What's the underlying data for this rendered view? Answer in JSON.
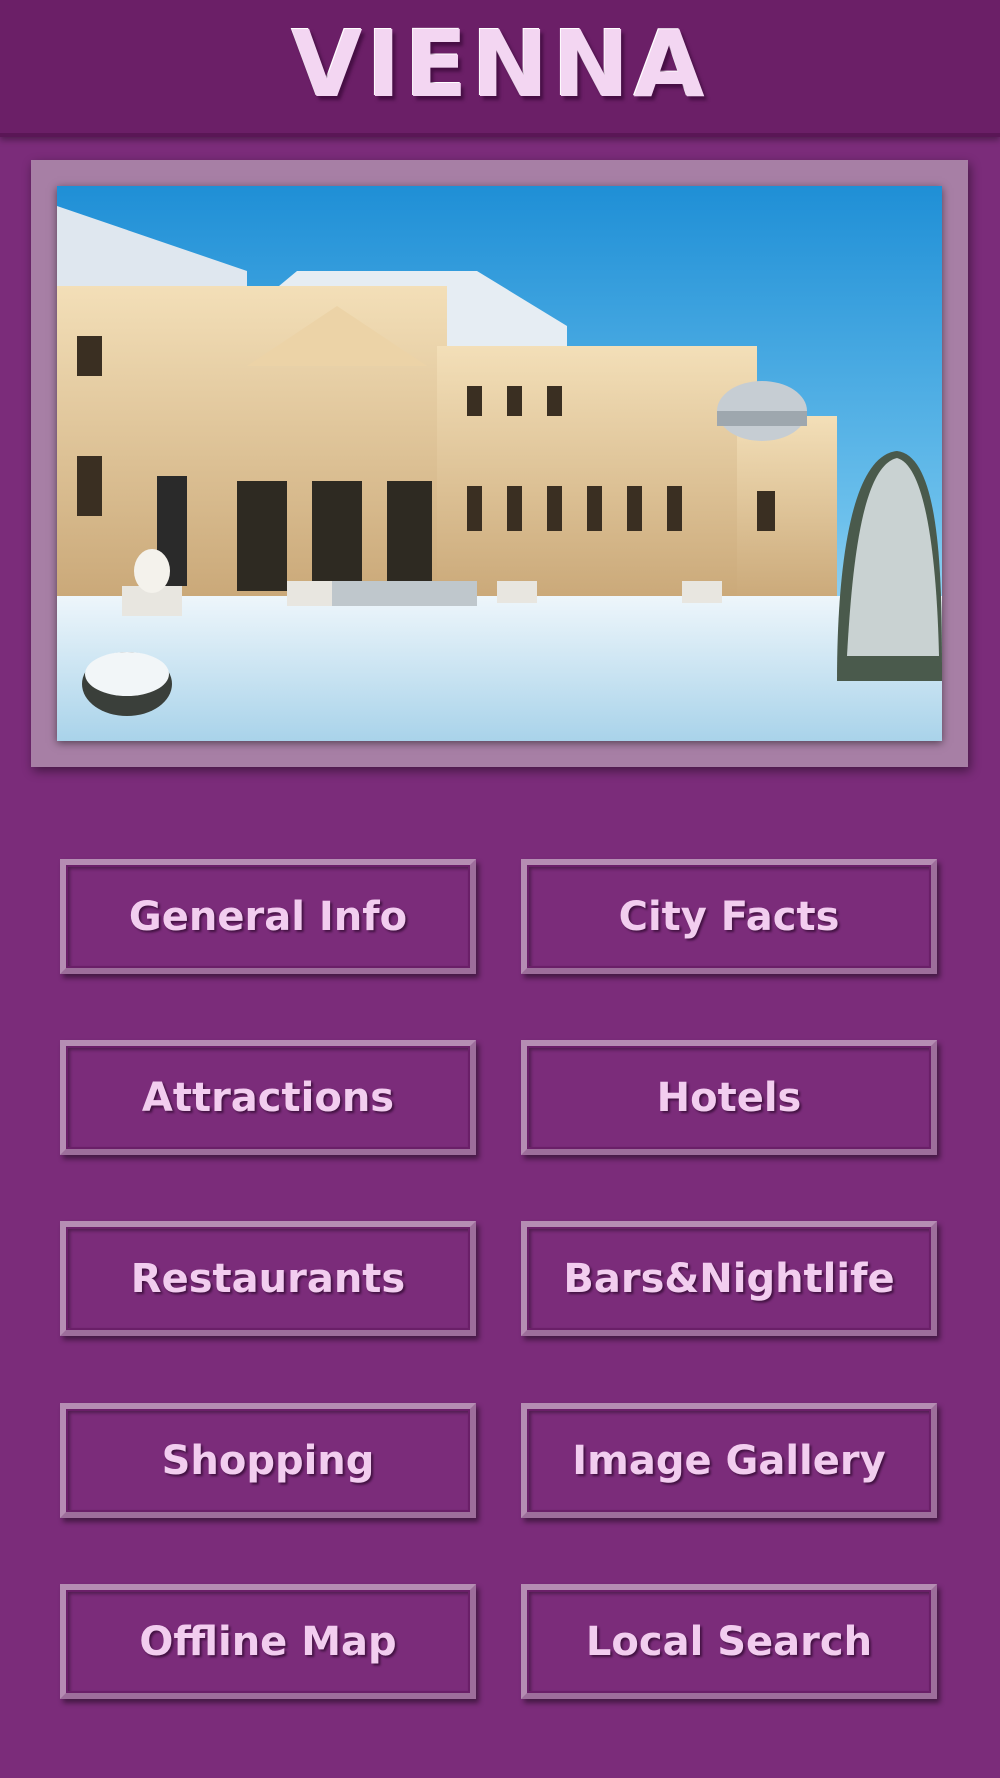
{
  "header": {
    "title": "VIENNA"
  },
  "hero": {
    "image": "belvedere-palace-winter-photo"
  },
  "menu": {
    "items": [
      {
        "label": "General Info"
      },
      {
        "label": "City Facts"
      },
      {
        "label": "Attractions"
      },
      {
        "label": "Hotels"
      },
      {
        "label": "Restaurants"
      },
      {
        "label": "Bars&Nightlife"
      },
      {
        "label": "Shopping"
      },
      {
        "label": "Image Gallery"
      },
      {
        "label": "Offline Map"
      },
      {
        "label": "Local Search"
      }
    ]
  },
  "colors": {
    "background": "#7b2c7a",
    "header": "#6b1f67",
    "button_text": "#f2cdef",
    "frame": "#a77fa5"
  }
}
